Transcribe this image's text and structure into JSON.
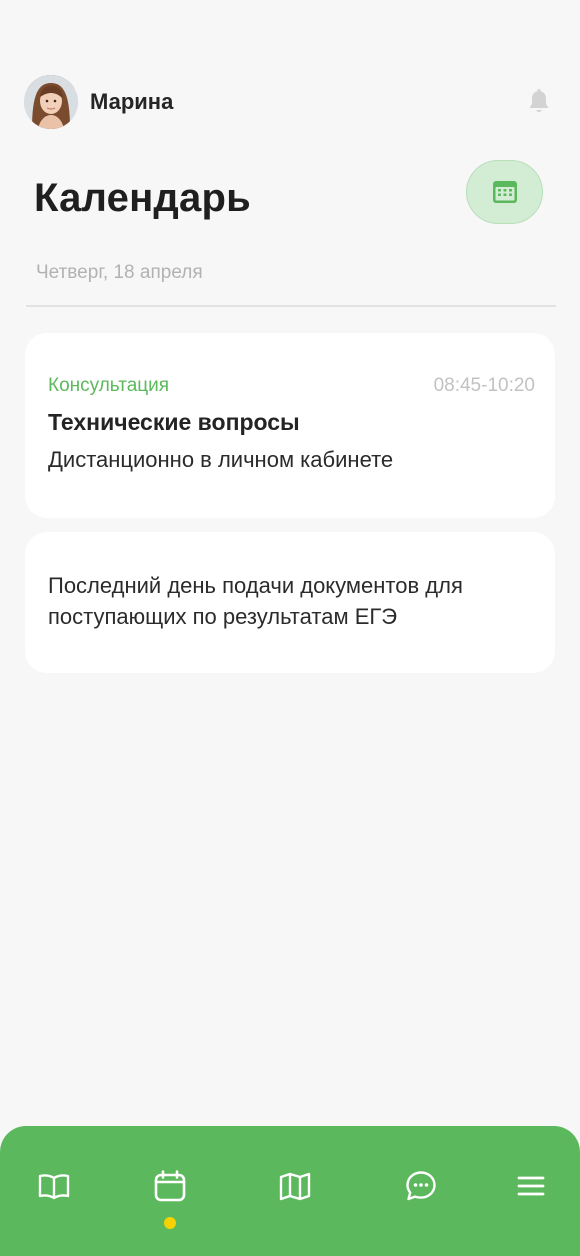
{
  "header": {
    "user_name": "Марина",
    "avatar_icon": "user-photo",
    "bell_icon": "bell-icon"
  },
  "page": {
    "title": "Календарь",
    "calendar_button_icon": "calendar-grid-icon",
    "date": "Четверг, 18 апреля"
  },
  "events": [
    {
      "category": "Консультация",
      "time": "08:45-10:20",
      "title": "Технические вопросы",
      "subtitle": "Дистанционно в личном кабинете"
    },
    {
      "text": "Последний день подачи документов для поступающих по результатам ЕГЭ"
    }
  ],
  "tabbar": {
    "tabs": [
      {
        "icon": "book-icon"
      },
      {
        "icon": "calendar-icon",
        "active": true
      },
      {
        "icon": "map-icon"
      },
      {
        "icon": "chat-icon"
      },
      {
        "icon": "menu-icon"
      }
    ]
  },
  "colors": {
    "accent": "#5cb85c",
    "accent_light": "#d3ecd4",
    "active_dot": "#f6d200",
    "background": "#f7f7f7"
  }
}
